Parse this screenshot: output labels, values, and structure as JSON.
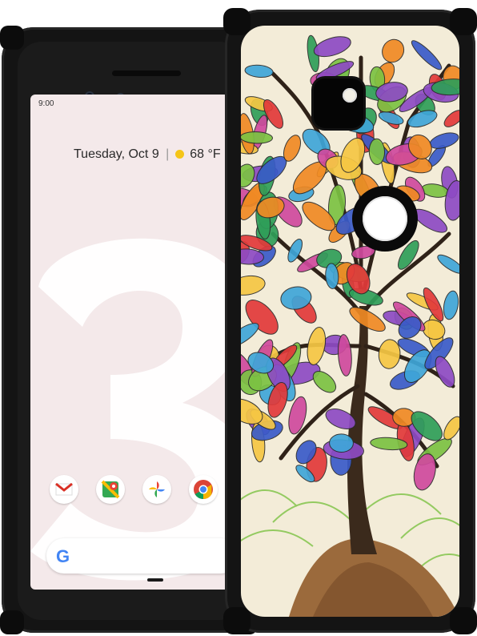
{
  "front_phone": {
    "status_time": "9:00",
    "at_a_glance": {
      "date": "Tuesday, Oct 9",
      "separator": "|",
      "temperature": "68 °F"
    },
    "dock_apps": [
      {
        "name": "Gmail",
        "icon": "gmail-icon"
      },
      {
        "name": "Maps",
        "icon": "maps-icon"
      },
      {
        "name": "Photos",
        "icon": "photos-icon"
      },
      {
        "name": "Chrome",
        "icon": "chrome-icon"
      }
    ],
    "search_logo": "G",
    "wallpaper_digit_color": "#ffffff",
    "screen_color": "#f4e9ea"
  },
  "back_phone": {
    "artwork": "tree-of-life-leaves",
    "case_color": "#141414",
    "leaf_colors": [
      "#e23a3a",
      "#f08a24",
      "#f6c744",
      "#7cc243",
      "#2f9e59",
      "#3fa6d9",
      "#3a5bc9",
      "#8e4bc4",
      "#d04a9e"
    ]
  }
}
